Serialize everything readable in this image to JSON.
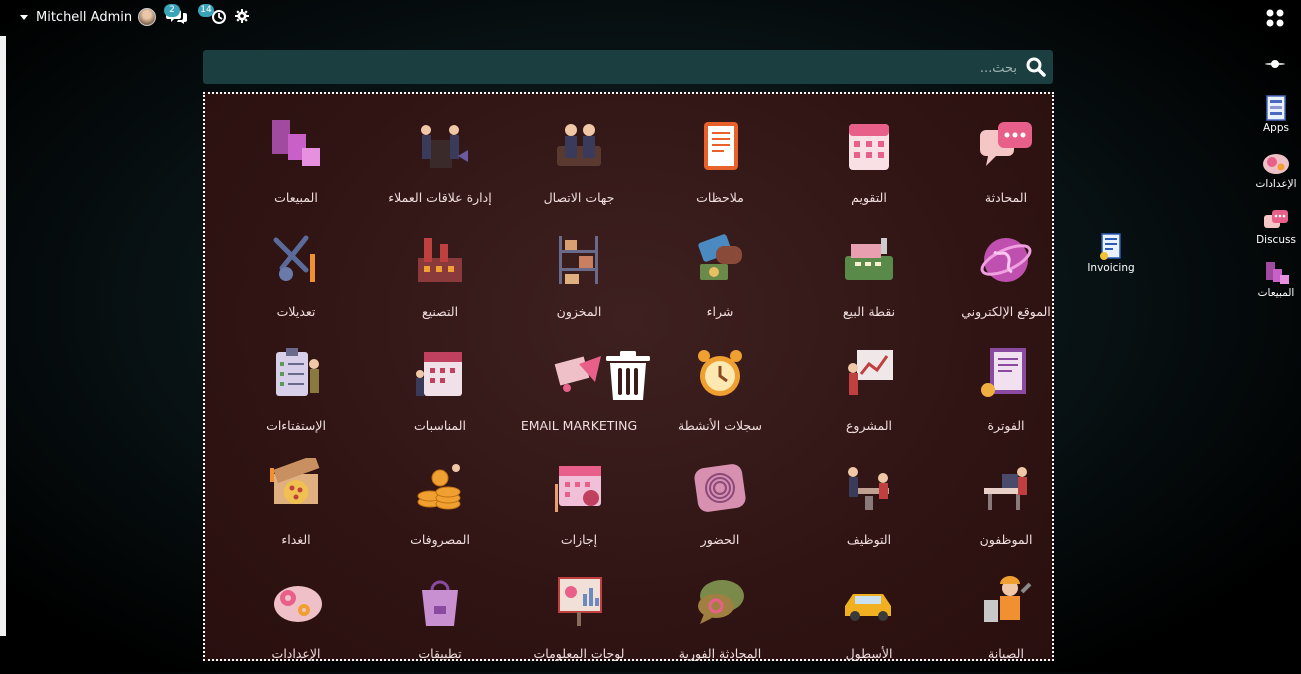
{
  "topbar": {
    "user_name": "Mitchell Admin",
    "messages_count": "2",
    "activities_count": "14"
  },
  "search": {
    "placeholder": "بحث..."
  },
  "apps": [
    {
      "label": "المحادثة",
      "icon": "chat-bubbles-icon"
    },
    {
      "label": "التقويم",
      "icon": "calendar-icon"
    },
    {
      "label": "ملاحظات",
      "icon": "notes-icon"
    },
    {
      "label": "جهات الاتصال",
      "icon": "contacts-icon"
    },
    {
      "label": "إدارة علاقات العملاء",
      "icon": "crm-icon"
    },
    {
      "label": "المبيعات",
      "icon": "sales-cubes-icon"
    },
    {
      "label": "الموقع الإلكتروني",
      "icon": "website-globe-icon"
    },
    {
      "label": "نقطة البيع",
      "icon": "cash-register-icon"
    },
    {
      "label": "شراء",
      "icon": "purchase-card-icon"
    },
    {
      "label": "المخزون",
      "icon": "inventory-shelf-icon"
    },
    {
      "label": "التصنيع",
      "icon": "factory-icon"
    },
    {
      "label": "تعديلات",
      "icon": "tools-wrench-icon"
    },
    {
      "label": "الفوترة",
      "icon": "invoice-icon"
    },
    {
      "label": "المشروع",
      "icon": "project-board-icon"
    },
    {
      "label": "سجلات الأنشطة",
      "icon": "alarm-clock-icon"
    },
    {
      "label": "EMAIL MARKETING",
      "icon": "email-marketing-icon"
    },
    {
      "label": "المناسبات",
      "icon": "events-calendar-icon"
    },
    {
      "label": "الإستفتاءات",
      "icon": "surveys-clipboard-icon"
    },
    {
      "label": "الموظفون",
      "icon": "employees-desk-icon"
    },
    {
      "label": "التوظيف",
      "icon": "recruitment-icon"
    },
    {
      "label": "الحضور",
      "icon": "fingerprint-icon"
    },
    {
      "label": "إجازات",
      "icon": "time-off-calendar-icon"
    },
    {
      "label": "المصروفات",
      "icon": "expenses-coins-icon"
    },
    {
      "label": "الغداء",
      "icon": "lunch-pizza-icon"
    },
    {
      "label": "الصيانة",
      "icon": "maintenance-worker-icon"
    },
    {
      "label": "الأسطول",
      "icon": "fleet-car-icon"
    },
    {
      "label": "المحادثة الفورية",
      "icon": "live-chat-icon"
    },
    {
      "label": "لوحات المعلومات",
      "icon": "dashboard-board-icon"
    },
    {
      "label": "تطبيقات",
      "icon": "apps-bag-icon"
    },
    {
      "label": "الإعدادات",
      "icon": "settings-cloud-icon"
    }
  ],
  "dock": [
    {
      "label": "Apps",
      "icon": "apps-icon"
    },
    {
      "label": "الإعدادات",
      "icon": "settings-icon"
    },
    {
      "label": "Discuss",
      "icon": "discuss-icon"
    },
    {
      "label": "المبيعات",
      "icon": "sales-icon"
    }
  ],
  "desktop_item": {
    "label": "Invoicing",
    "icon": "invoicing-icon"
  },
  "colors": {
    "panel_bg": "#301414",
    "search_bg": "#1b3e40",
    "badge": "#3aa3b8",
    "accent_pink": "#e8608a"
  }
}
